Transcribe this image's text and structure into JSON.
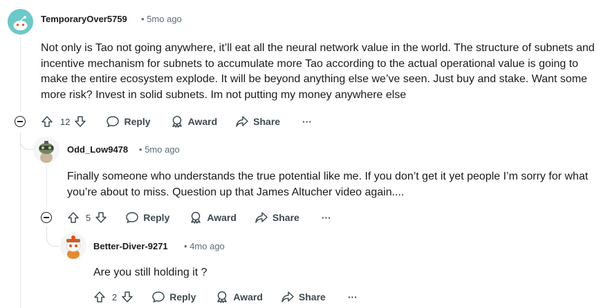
{
  "comments": [
    {
      "username": "TemporaryOver5759",
      "time": "5mo ago",
      "avatar_icon": "snoo-avatar-teal",
      "text": "Not only is Tao not going anywhere, it’ll eat all the neural network value in the world. The structure of subnets and incentive mechanism for subnets to accumulate more Tao according to the actual operational value is going to make the entire ecosystem explode. It will be beyond anything else we’ve seen. Just buy and stake. Want some more risk? Invest in solid subnets. Im not putting my money anywhere else",
      "votes": "12",
      "reply_label": "Reply",
      "award_label": "Award",
      "share_label": "Share",
      "more_label": "···"
    },
    {
      "username": "Odd_Low9478",
      "time": "5mo ago",
      "avatar_icon": "snoo-avatar-robot",
      "text": "Finally someone who understands the true potential like me. If you don’t get it yet people I’m sorry for what you’re about to miss. Question up that James Altucher video again....",
      "votes": "5",
      "reply_label": "Reply",
      "award_label": "Award",
      "share_label": "Share",
      "more_label": "···"
    },
    {
      "username": "Better-Diver-9271",
      "time": "4mo ago",
      "avatar_icon": "snoo-avatar-diver",
      "text": "Are you still holding it ?",
      "votes": "2",
      "reply_label": "Reply",
      "award_label": "Award",
      "share_label": "Share",
      "more_label": "···"
    }
  ],
  "meta_separator": "•",
  "colors": {
    "text": "#1a1a1b",
    "meta": "#576f76",
    "action": "#3c4a50",
    "thread": "#e5ebee"
  }
}
